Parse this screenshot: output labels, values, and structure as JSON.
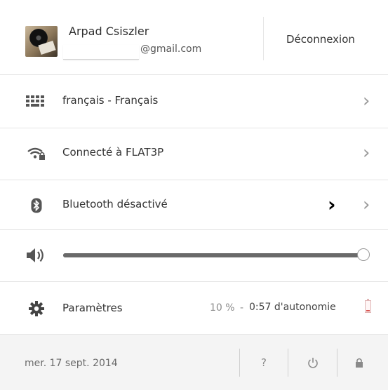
{
  "account": {
    "name": "Arpad Csiszler",
    "email_domain": "@gmail.com",
    "signout_label": "Déconnexion"
  },
  "rows": {
    "language": {
      "label": "français - Français",
      "icon": "keyboard-icon"
    },
    "wifi": {
      "label": "Connecté à FLAT3P",
      "icon": "wifi-lock-icon"
    },
    "bluetooth": {
      "label": "Bluetooth désactivé",
      "icon": "bluetooth-icon"
    },
    "volume": {
      "icon": "speaker-icon",
      "level_percent": 100
    },
    "settings": {
      "label": "Paramètres",
      "icon": "gear-icon",
      "battery_percent": "10 %",
      "battery_separator": "-",
      "battery_time": "0:57 d'autonomie"
    }
  },
  "footer": {
    "date": "mer. 17 sept. 2014",
    "help_label": "?",
    "power_icon": "power-icon",
    "lock_icon": "lock-icon"
  },
  "colors": {
    "battery_low": "#d9534f",
    "divider": "#e4e4e4",
    "footer_bg": "#f4f4f4"
  }
}
